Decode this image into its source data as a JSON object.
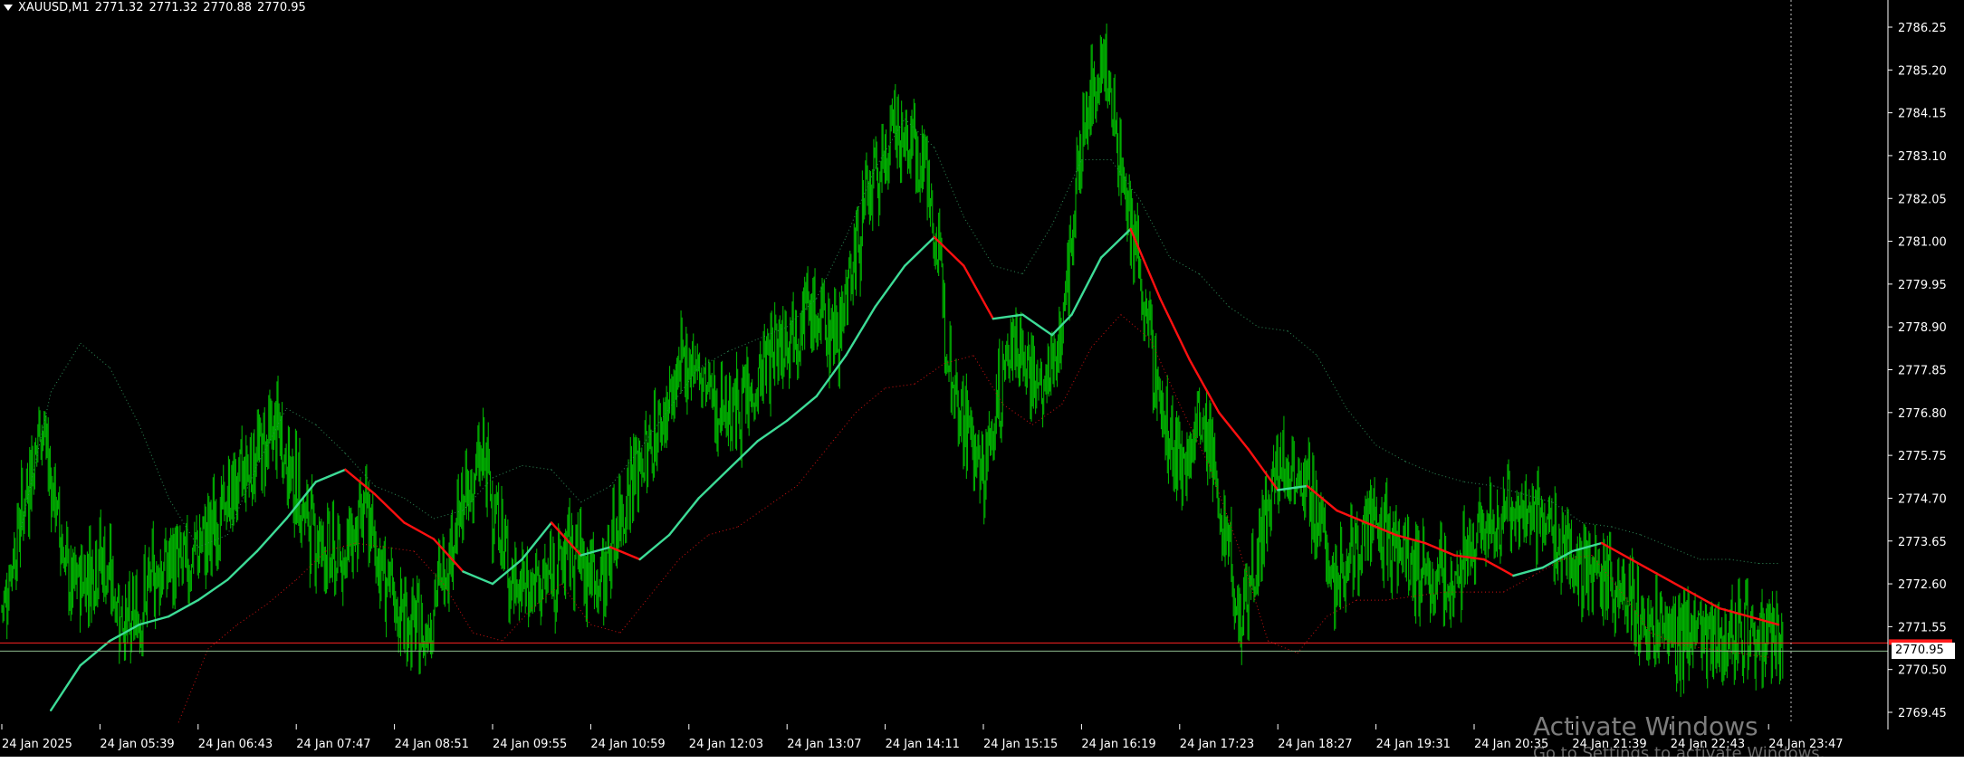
{
  "header": {
    "symbol": "XAUUSD,M1",
    "open": "2771.32",
    "high": "2771.32",
    "low": "2770.88",
    "close": "2770.95"
  },
  "current_price_label": "2770.95",
  "watermark": {
    "title": "Activate Windows",
    "subtitle": "Go to Settings to activate Windows."
  },
  "colors": {
    "background": "#000000",
    "bars": "#00b000",
    "ma_up": "#3ddc97",
    "ma_down": "#ff1010",
    "band_upper": "#2e8b57",
    "band_lower": "#cc1111",
    "axis_text": "#ffffff",
    "bid_line": "#ff2222",
    "ask_line": "#8fbc8f"
  },
  "chart_data": {
    "type": "line",
    "symbol": "XAUUSD",
    "timeframe": "M1",
    "ylim": [
      2768.9,
      2786.6
    ],
    "y_ticks": [
      "2786.25",
      "2785.20",
      "2784.15",
      "2783.10",
      "2782.05",
      "2781.00",
      "2779.95",
      "2778.90",
      "2777.85",
      "2776.80",
      "2775.75",
      "2774.70",
      "2773.65",
      "2772.60",
      "2771.55",
      "2770.50",
      "2769.45"
    ],
    "x_ticks": [
      "24 Jan 2025",
      "24 Jan 05:39",
      "24 Jan 06:43",
      "24 Jan 07:47",
      "24 Jan 08:51",
      "24 Jan 09:55",
      "24 Jan 10:59",
      "24 Jan 12:03",
      "24 Jan 13:07",
      "24 Jan 14:11",
      "24 Jan 15:15",
      "24 Jan 16:19",
      "24 Jan 17:23",
      "24 Jan 18:27",
      "24 Jan 19:31",
      "24 Jan 20:35",
      "24 Jan 21:39",
      "24 Jan 22:43",
      "24 Jan 23:47"
    ],
    "x_tick_index": [
      0,
      1,
      2,
      3,
      4,
      5,
      6,
      7,
      8,
      9,
      10,
      11,
      12,
      13,
      14,
      15,
      16,
      17,
      18
    ],
    "price_path": {
      "x": [
        0,
        0.4,
        0.7,
        1.0,
        1.3,
        1.6,
        1.9,
        2.2,
        2.5,
        2.8,
        3.1,
        3.4,
        3.7,
        4.0,
        4.3,
        4.6,
        4.9,
        5.2,
        5.5,
        5.8,
        6.1,
        6.4,
        6.7,
        7.0,
        7.3,
        7.6,
        7.9,
        8.2,
        8.5,
        8.8,
        9.1,
        9.4,
        9.7,
        10.0,
        10.3,
        10.6,
        10.8,
        11.0,
        11.2,
        11.4,
        11.6,
        11.8,
        12.0,
        12.2,
        12.4,
        12.6,
        12.8,
        13.0,
        13.2,
        13.4,
        13.6,
        13.8,
        14.1,
        14.4,
        14.7,
        15.0,
        15.3,
        15.6,
        15.9,
        16.2,
        16.5,
        16.8,
        17.1,
        17.4,
        17.7,
        18.0,
        18.15
      ],
      "y": [
        2772.0,
        2776.6,
        2772.4,
        2773.3,
        2771.4,
        2773.0,
        2773.1,
        2774.1,
        2775.5,
        2776.4,
        2774.2,
        2773.1,
        2774.3,
        2772.0,
        2771.3,
        2773.8,
        2775.7,
        2772.6,
        2772.5,
        2773.5,
        2772.6,
        2775.1,
        2776.4,
        2778.2,
        2776.9,
        2777.0,
        2778.6,
        2779.2,
        2778.7,
        2781.8,
        2783.7,
        2783.1,
        2777.5,
        2775.2,
        2778.8,
        2777.1,
        2778.9,
        2783.3,
        2785.6,
        2783.1,
        2780.1,
        2777.0,
        2775.2,
        2776.6,
        2774.9,
        2771.8,
        2773.4,
        2775.3,
        2775.6,
        2774.3,
        2772.6,
        2773.7,
        2773.9,
        2773.0,
        2772.6,
        2773.3,
        2774.5,
        2774.3,
        2773.6,
        2773.0,
        2772.5,
        2771.3,
        2771.3,
        2771.4,
        2771.5,
        2771.1,
        2771.0
      ]
    },
    "series": [
      {
        "x": [
          0.5,
          0.8,
          1.1,
          1.4,
          1.7,
          2.0,
          2.3,
          2.6,
          2.9,
          3.2,
          3.5,
          3.8,
          4.1,
          4.4,
          4.7,
          5.0,
          5.3,
          5.6,
          5.9,
          6.2,
          6.5,
          6.8,
          7.1,
          7.4,
          7.7,
          8.0,
          8.3,
          8.6,
          8.9,
          9.2,
          9.5,
          9.8,
          10.1,
          10.4,
          10.7,
          10.9,
          11.2,
          11.5,
          11.8,
          12.1,
          12.4,
          12.7,
          13.0,
          13.3,
          13.6,
          13.9,
          14.2,
          14.5,
          14.8,
          15.1,
          15.4,
          15.7,
          16.0,
          16.3,
          16.6,
          16.9,
          17.2,
          17.5,
          17.8,
          18.1
        ],
        "y": [
          2769.5,
          2770.6,
          2771.2,
          2771.6,
          2771.8,
          2772.2,
          2772.7,
          2773.4,
          2774.2,
          2775.1,
          2775.4,
          2774.8,
          2774.1,
          2773.7,
          2772.9,
          2772.6,
          2773.2,
          2774.1,
          2773.3,
          2773.5,
          2773.2,
          2773.8,
          2774.7,
          2775.4,
          2776.1,
          2776.6,
          2777.2,
          2778.2,
          2779.4,
          2780.4,
          2781.1,
          2780.4,
          2779.1,
          2779.2,
          2778.7,
          2779.2,
          2780.6,
          2781.3,
          2779.6,
          2778.1,
          2776.8,
          2775.9,
          2774.9,
          2775.0,
          2774.4,
          2774.1,
          2773.8,
          2773.6,
          2773.3,
          2773.2,
          2772.8,
          2773.0,
          2773.4,
          2773.6,
          2773.2,
          2772.8,
          2772.4,
          2772.0,
          2771.8,
          2771.6
        ],
        "trend": [
          "up",
          "up",
          "up",
          "up",
          "up",
          "up",
          "up",
          "up",
          "up",
          "up",
          "up",
          "down",
          "down",
          "down",
          "down",
          "up",
          "up",
          "up",
          "down",
          "up",
          "down",
          "up",
          "up",
          "up",
          "up",
          "up",
          "up",
          "up",
          "up",
          "up",
          "up",
          "down",
          "down",
          "up",
          "up",
          "up",
          "up",
          "up",
          "down",
          "down",
          "down",
          "down",
          "down",
          "up",
          "down",
          "down",
          "down",
          "down",
          "down",
          "down",
          "down",
          "up",
          "up",
          "up",
          "down",
          "down",
          "down",
          "down",
          "down",
          "down"
        ]
      },
      {
        "x": [
          0.2,
          0.5,
          0.8,
          1.1,
          1.4,
          1.7,
          2.0,
          2.3,
          2.6,
          2.9,
          3.2,
          3.5,
          3.8,
          4.1,
          4.4,
          4.7,
          5.0,
          5.3,
          5.6,
          5.9,
          6.2,
          6.5,
          6.8,
          7.1,
          7.4,
          7.7,
          8.0,
          8.3,
          8.6,
          8.9,
          9.2,
          9.5,
          9.8,
          10.1,
          10.4,
          10.7,
          11.0,
          11.3,
          11.6,
          11.9,
          12.2,
          12.5,
          12.8,
          13.1,
          13.4,
          13.7,
          14.0,
          14.3,
          14.6,
          14.9,
          15.2,
          15.5,
          15.8,
          16.1,
          16.4,
          16.7,
          17.0,
          17.3,
          17.6,
          17.9,
          18.1
        ],
        "y": [
          2774.0,
          2777.3,
          2778.5,
          2777.9,
          2776.5,
          2774.7,
          2773.5,
          2773.8,
          2775.5,
          2776.9,
          2776.5,
          2775.8,
          2775.0,
          2774.7,
          2774.2,
          2774.4,
          2775.2,
          2775.5,
          2775.4,
          2774.6,
          2775.0,
          2775.9,
          2776.9,
          2777.9,
          2778.3,
          2778.6,
          2778.9,
          2779.6,
          2781.1,
          2782.8,
          2784.0,
          2783.3,
          2781.6,
          2780.4,
          2780.2,
          2781.4,
          2783.0,
          2783.0,
          2782.0,
          2780.6,
          2780.2,
          2779.4,
          2778.9,
          2778.8,
          2778.2,
          2776.9,
          2776.0,
          2775.6,
          2775.3,
          2775.1,
          2775.0,
          2774.8,
          2774.6,
          2774.1,
          2774.0,
          2773.8,
          2773.5,
          2773.2,
          2773.2,
          2773.1,
          2773.1
        ]
      },
      {
        "x": [
          1.8,
          2.1,
          2.4,
          2.7,
          3.0,
          3.3,
          3.6,
          3.9,
          4.2,
          4.5,
          4.8,
          5.1,
          5.4,
          5.7,
          6.0,
          6.3,
          6.6,
          6.9,
          7.2,
          7.5,
          7.8,
          8.1,
          8.4,
          8.7,
          9.0,
          9.3,
          9.6,
          9.9,
          10.2,
          10.5,
          10.8,
          11.1,
          11.4,
          11.7,
          12.0,
          12.3,
          12.6,
          12.9,
          13.2,
          13.5,
          13.8,
          14.1,
          14.4,
          14.7,
          15.0,
          15.3,
          15.6,
          15.9,
          16.2,
          16.5,
          16.8,
          17.1,
          17.4,
          17.7,
          18.0
        ],
        "y": [
          2769.2,
          2771.0,
          2771.6,
          2772.1,
          2772.7,
          2773.4,
          2773.6,
          2773.5,
          2773.4,
          2772.6,
          2771.4,
          2771.2,
          2772.0,
          2772.6,
          2771.6,
          2771.4,
          2772.3,
          2773.2,
          2773.8,
          2774.0,
          2774.5,
          2775.0,
          2775.9,
          2776.8,
          2777.4,
          2777.5,
          2778.0,
          2778.2,
          2777.0,
          2776.5,
          2777.0,
          2778.4,
          2779.2,
          2778.6,
          2777.0,
          2775.5,
          2773.5,
          2771.2,
          2770.9,
          2771.8,
          2772.2,
          2772.2,
          2772.3,
          2772.4,
          2772.4,
          2772.4,
          2772.8,
          2773.2,
          2773.3,
          2772.4,
          2771.4,
          2771.1,
          2771.0,
          2770.9,
          2770.8
        ]
      }
    ],
    "bid_price": 2770.95,
    "ask_price": 2771.15,
    "grid": false
  }
}
